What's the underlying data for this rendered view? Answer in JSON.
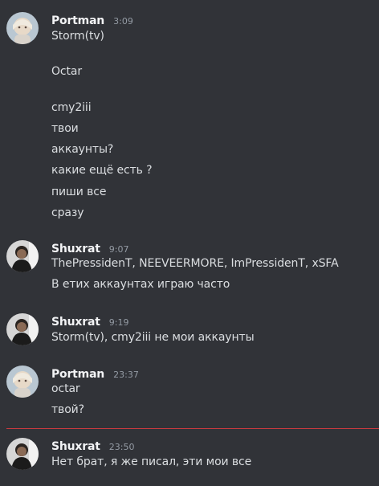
{
  "messages": [
    {
      "author": "Portman",
      "time": "3:09",
      "avatar_icon": "portman-avatar-icon",
      "lines": [
        "Storm(tv)",
        "Octar",
        "cmy2iii",
        "твои",
        "аккаунты?",
        "какие ещё есть ?",
        "пиши все",
        "сразу"
      ]
    },
    {
      "author": "Shuxrat",
      "time": "9:07",
      "avatar_icon": "shuxrat-avatar-icon",
      "lines": [
        "ThePressidenT, NEEVEERMORE, ImPressidenT, xSFA",
        "В етих аккаунтах играю часто"
      ]
    },
    {
      "author": "Shuxrat",
      "time": "9:19",
      "avatar_icon": "shuxrat-avatar-icon",
      "lines": [
        "Storm(tv), cmy2iii не мои аккаунты"
      ]
    },
    {
      "author": "Portman",
      "time": "23:37",
      "avatar_icon": "portman-avatar-icon",
      "lines": [
        "octar",
        "твой?"
      ]
    },
    {
      "author": "Shuxrat",
      "time": "23:50",
      "avatar_icon": "shuxrat-avatar-icon",
      "lines": [
        "Нет брат, я же писал, эти мои все"
      ]
    }
  ],
  "colors": {
    "background": "#313338",
    "author": "#f2f3f5",
    "text": "#dbdee1",
    "timestamp": "#949ba4",
    "new_divider": "#c73a3f"
  }
}
